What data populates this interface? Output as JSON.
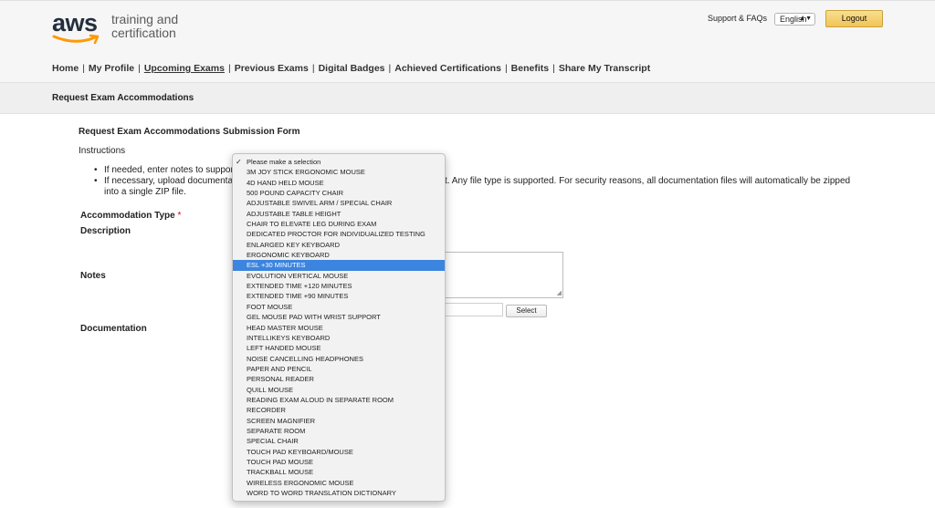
{
  "header": {
    "logo": {
      "brand": "aws",
      "line1": "training and",
      "line2": "certification"
    },
    "support_label": "Support & FAQs",
    "language_selected": "English",
    "logout_label": "Logout"
  },
  "nav": {
    "items": [
      "Home",
      "My Profile",
      "Upcoming Exams",
      "Previous Exams",
      "Digital Badges",
      "Achieved Certifications",
      "Benefits",
      "Share My Transcript"
    ],
    "active": "Upcoming Exams"
  },
  "section_title": "Request Exam Accommodations",
  "form": {
    "title": "Request Exam Accommodations Submission Form",
    "instructions_label": "Instructions",
    "bullet1": "If needed, enter notes to suppor",
    "bullet2_visible": "If necessary, upload documenta",
    "bullet2_tail": "t. Any file type is supported. For security reasons, all documentation files will automatically be zipped",
    "bullet2_line2": "into a single ZIP file.",
    "accommodation_type_label": "Accommodation Type",
    "required_marker": "*",
    "description_label": "Description",
    "notes_label": "Notes",
    "documentation_label": "Documentation",
    "select_button_label": "Select"
  },
  "dropdown": {
    "highlighted_index": 11,
    "checked_index": 0,
    "options": [
      "Please make a selection",
      "3M JOY STICK ERGONOMIC MOUSE",
      "4D HAND HELD MOUSE",
      "500 POUND CAPACITY CHAIR",
      "ADJUSTABLE SWIVEL ARM / SPECIAL CHAIR",
      "ADJUSTABLE TABLE HEIGHT",
      "CHAIR TO ELEVATE LEG DURING EXAM",
      "DEDICATED PROCTOR FOR INDIVIDUALIZED TESTING",
      "ENLARGED KEY KEYBOARD",
      "ERGONOMIC KEYBOARD",
      "ESL +30 MINUTES",
      "EVOLUTION VERTICAL MOUSE",
      "EXTENDED TIME +120 MINUTES",
      "EXTENDED TIME +90 MINUTES",
      "FOOT MOUSE",
      "GEL MOUSE PAD WITH WRIST SUPPORT",
      "HEAD MASTER MOUSE",
      "INTELLIKEYS KEYBOARD",
      "LEFT HANDED MOUSE",
      "NOISE CANCELLING HEADPHONES",
      "PAPER AND PENCIL",
      "PERSONAL READER",
      "QUILL MOUSE",
      "READING EXAM ALOUD IN SEPARATE ROOM",
      "RECORDER",
      "SCREEN MAGNIFIER",
      "SEPARATE ROOM",
      "SPECIAL CHAIR",
      "TOUCH PAD KEYBOARD/MOUSE",
      "TOUCH PAD MOUSE",
      "TRACKBALL MOUSE",
      "WIRELESS ERGONOMIC MOUSE",
      "WORD TO WORD TRANSLATION DICTIONARY"
    ]
  },
  "colors": {
    "logout_button": "#f1c456",
    "highlight": "#3b84e0",
    "required": "#d0021b",
    "aws_smile": "#ff9900"
  }
}
